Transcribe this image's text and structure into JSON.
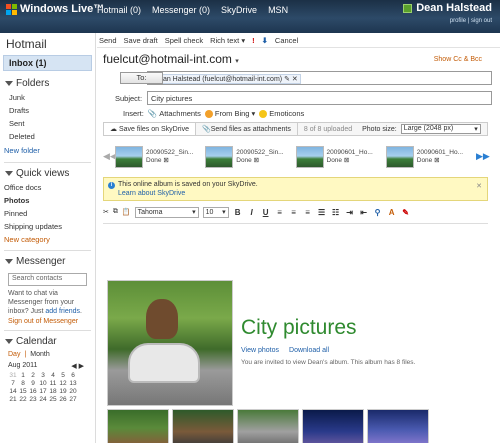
{
  "topbar": {
    "brand": "Windows Live™",
    "nav": [
      "Hotmail (0)",
      "Messenger (0)",
      "SkyDrive",
      "MSN"
    ],
    "user_name": "Dean Halstead",
    "links": [
      "profile",
      "sign out"
    ]
  },
  "sidebar": {
    "brand": "Hotmail",
    "inbox": "Inbox (1)",
    "folders_title": "Folders",
    "folders": [
      "Junk",
      "Drafts",
      "Sent",
      "Deleted"
    ],
    "new_folder": "New folder",
    "quick_title": "Quick views",
    "quick": [
      "Office docs",
      "Photos",
      "Pinned",
      "Shipping updates"
    ],
    "new_category": "New category",
    "messenger_title": "Messenger",
    "search_placeholder": "Search contacts",
    "messenger_text": "Want to chat via Messenger from your inbox? Just",
    "add_friends": "add friends",
    "sign_out_messenger": "Sign out of Messenger",
    "calendar_title": "Calendar",
    "cal_day": "Day",
    "cal_month": "Month",
    "cal_month_label": "Aug 2011",
    "cal_days": [
      "31",
      "1",
      "2",
      "3",
      "4",
      "5",
      "6",
      "7",
      "8",
      "9",
      "10",
      "11",
      "12",
      "13",
      "14",
      "15",
      "16",
      "17",
      "18",
      "19",
      "20",
      "21",
      "22",
      "23",
      "24",
      "25",
      "26",
      "27"
    ]
  },
  "toolbar": {
    "send": "Send",
    "save_draft": "Save draft",
    "spell": "Spell check",
    "rich": "Rich text",
    "cancel": "Cancel"
  },
  "compose": {
    "from": "fuelcut@hotmail-int.com",
    "show_cc": "Show Cc & Bcc",
    "to_label": "To:",
    "to_value": "Dean Halstead (fuelcut@hotmail-int.com)",
    "subject_label": "Subject:",
    "subject_value": "City pictures",
    "insert_label": "Insert:",
    "attachments": "Attachments",
    "from_bing": "From Bing",
    "emoticons": "Emoticons"
  },
  "skydrive": {
    "tab_save": "Save files on SkyDrive",
    "tab_send": "Send files as attachments",
    "uploaded": "8 of 8 uploaded",
    "photo_size_label": "Photo size:",
    "photo_size_value": "Large (2048 px)",
    "thumbs": [
      {
        "name": "20090522_Sin...",
        "status": "Done"
      },
      {
        "name": "20090522_Sin...",
        "status": "Done"
      },
      {
        "name": "20090601_Ho...",
        "status": "Done"
      },
      {
        "name": "20090601_Ho...",
        "status": "Done"
      }
    ]
  },
  "info": {
    "text": "This online album is saved on your SkyDrive.",
    "link": "Learn about SkyDrive"
  },
  "format": {
    "font": "Tahoma",
    "size": "10"
  },
  "album": {
    "title": "City pictures",
    "view_photos": "View photos",
    "download_all": "Download all",
    "invite": "You are invited to view Dean's album. This album has 8 files."
  }
}
